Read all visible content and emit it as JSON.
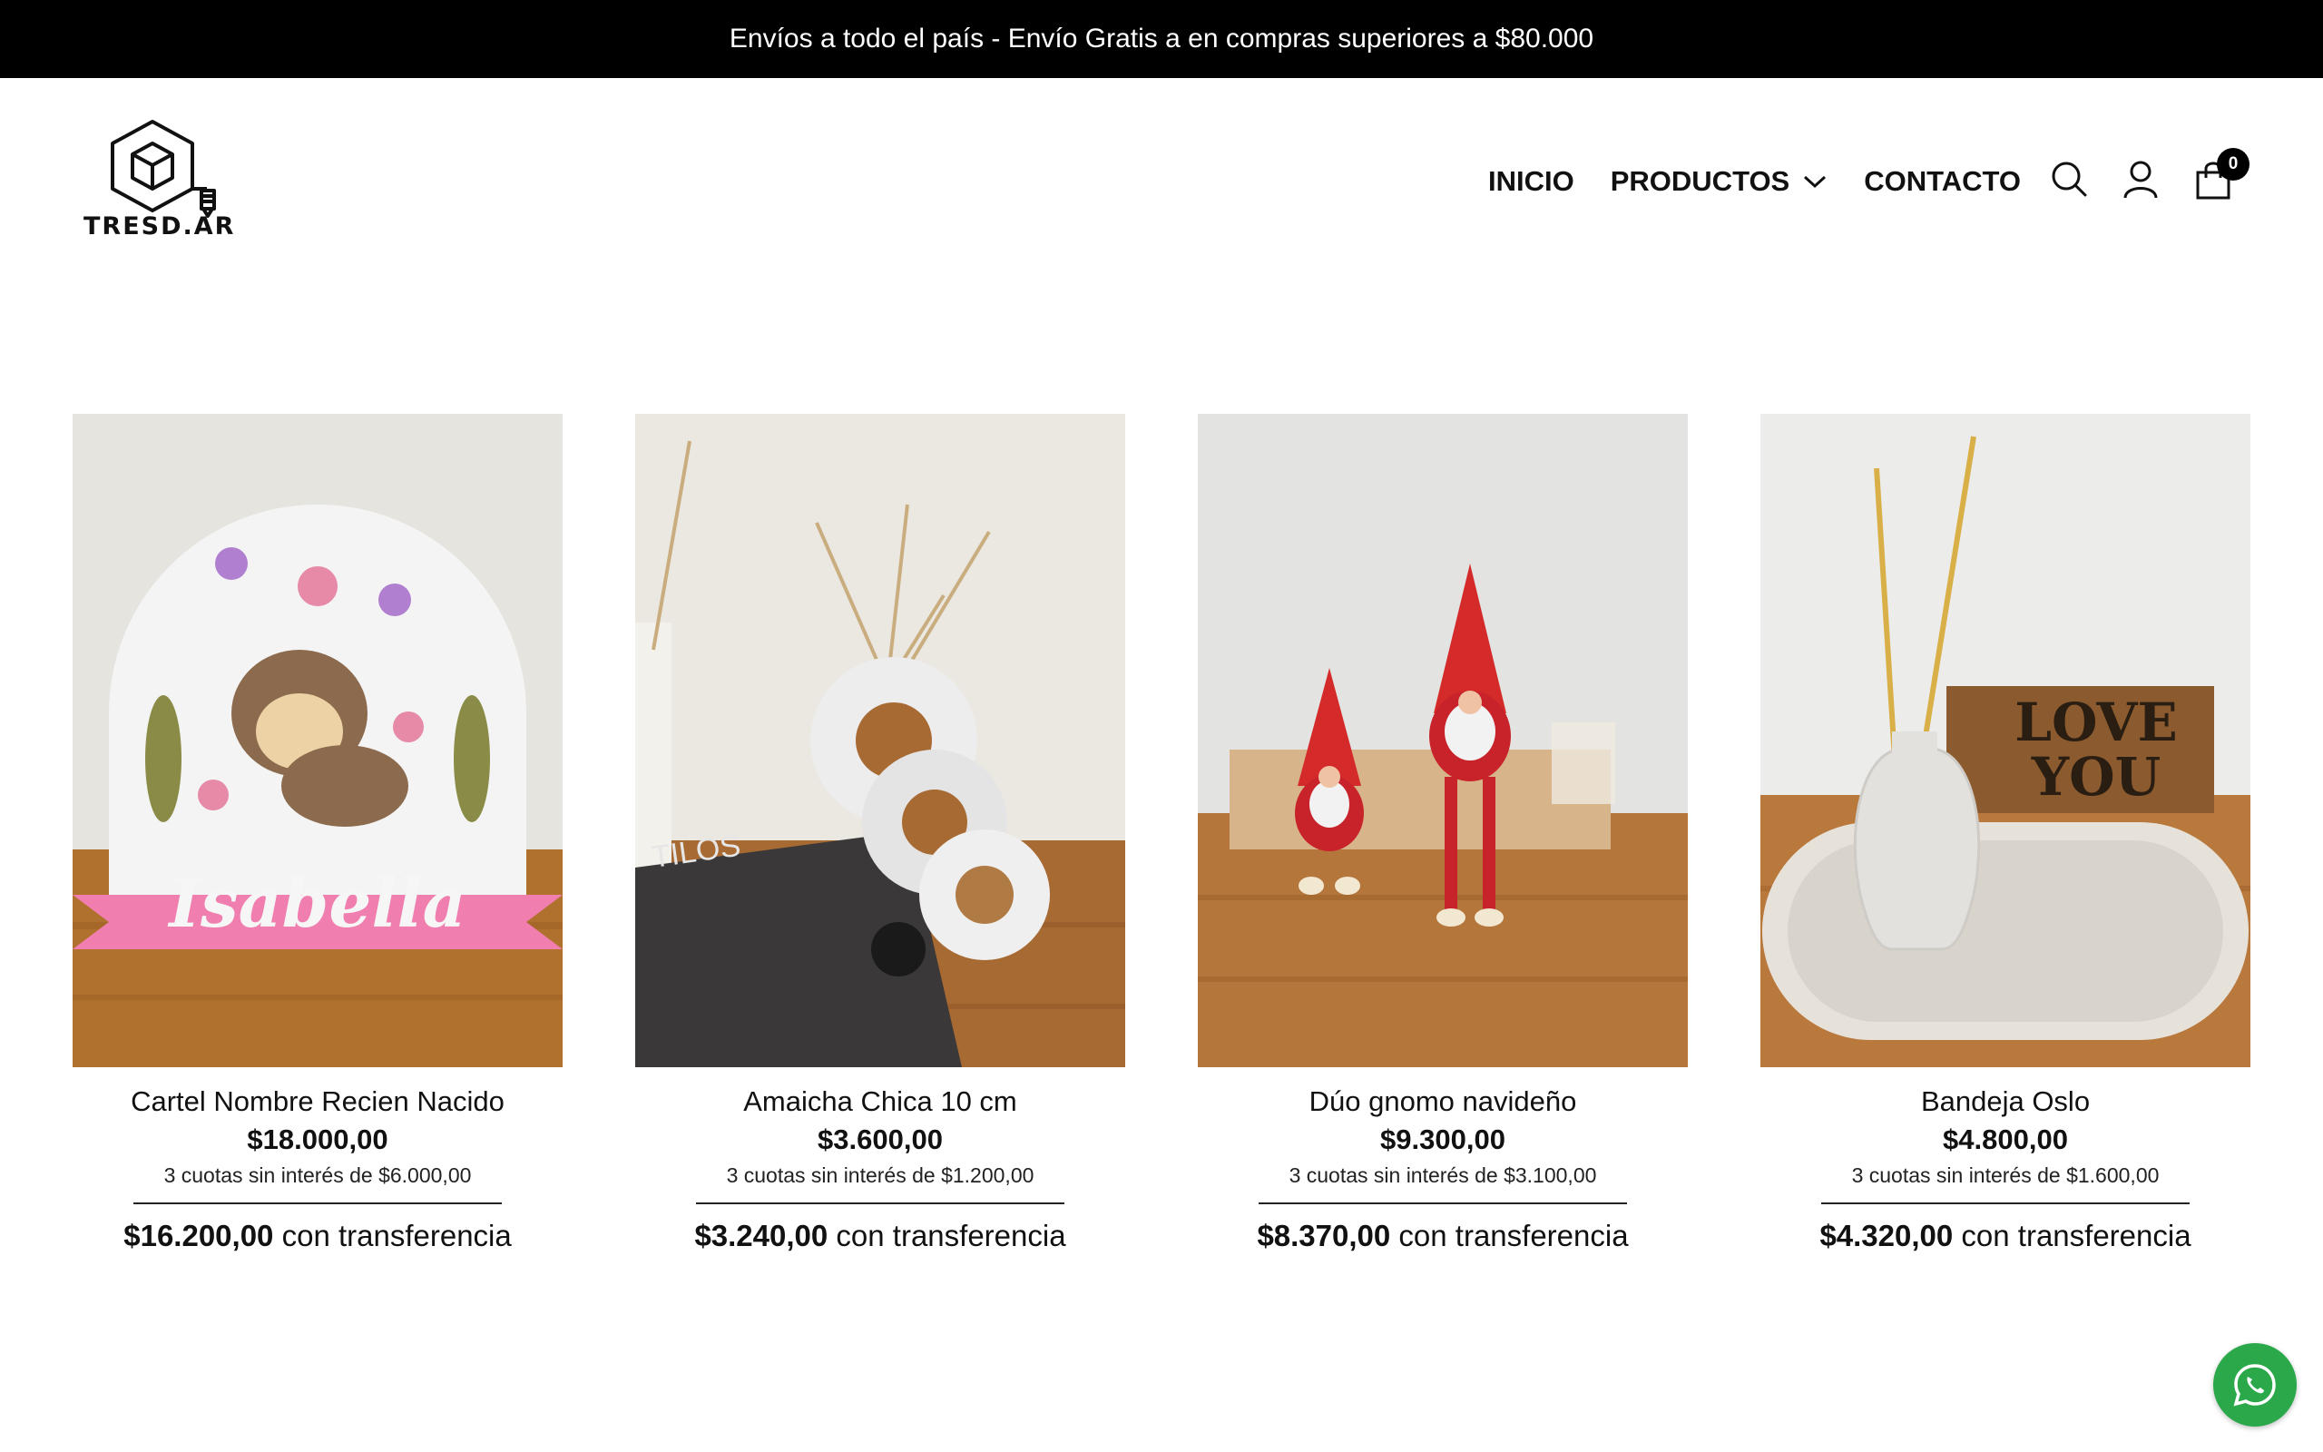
{
  "announcement": "Envíos a todo el país - Envío Gratis a en compras superiores a $80.000",
  "brand": {
    "name": "TRESD.AR"
  },
  "nav": {
    "items": [
      {
        "label": "INICIO"
      },
      {
        "label": "PRODUCTOS"
      },
      {
        "label": "CONTACTO"
      }
    ],
    "cart_count": "0"
  },
  "products": [
    {
      "name": "Cartel Nombre Recien Nacido",
      "price": "$18.000,00",
      "installments": "3 cuotas sin interés de $6.000,00",
      "transfer_price": "$16.200,00",
      "transfer_label": "con transferencia",
      "image_text": "Isabella"
    },
    {
      "name": "Amaicha Chica 10 cm",
      "price": "$3.600,00",
      "installments": "3 cuotas sin interés de $1.200,00",
      "transfer_price": "$3.240,00",
      "transfer_label": "con transferencia",
      "image_text": "TILOS"
    },
    {
      "name": "Dúo gnomo navideño",
      "price": "$9.300,00",
      "installments": "3 cuotas sin interés de $3.100,00",
      "transfer_price": "$8.370,00",
      "transfer_label": "con transferencia"
    },
    {
      "name": "Bandeja Oslo",
      "price": "$4.800,00",
      "installments": "3 cuotas sin interés de $1.600,00",
      "transfer_price": "$4.320,00",
      "transfer_label": "con transferencia",
      "image_text": [
        "LOVE",
        "YOU"
      ]
    }
  ],
  "icons": [
    "logo-icon",
    "chevron-down-icon",
    "search-icon",
    "user-icon",
    "cart-icon",
    "whatsapp-icon"
  ],
  "colors": {
    "announcement_bg": "#000000",
    "whatsapp": "#2aa84a",
    "text": "#111111"
  }
}
